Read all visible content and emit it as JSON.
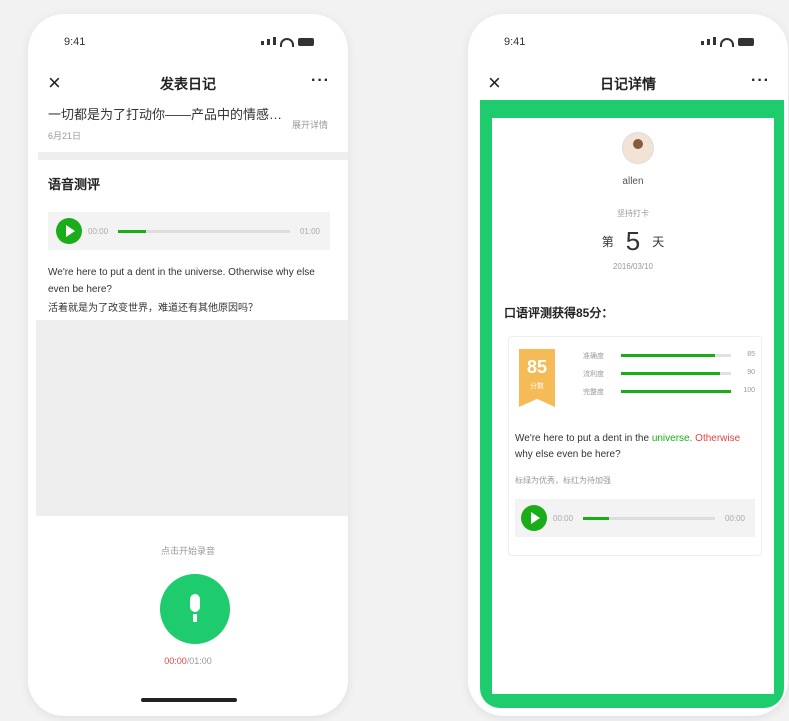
{
  "status_time": "9:41",
  "left": {
    "nav": {
      "close": "×",
      "title": "发表日记",
      "more": "···"
    },
    "entry": {
      "text": "一切都是为了打动你——产品中的情感…",
      "date": "6月21日",
      "link": "展开详情"
    },
    "voice_title": "语音测评",
    "player": {
      "current": "00:00",
      "duration": "01:00",
      "progress": 0.16
    },
    "english": "We're here to put a dent in the universe. Otherwise why else even be here?",
    "chinese": "活着就是为了改变世界，难道还有其他原因吗？",
    "record_hint": "点击开始录音",
    "timer": {
      "current": "00:00",
      "total": "/01:00"
    }
  },
  "right": {
    "nav": {
      "close": "×",
      "title": "日记详情",
      "more": "···"
    },
    "user_name": "allen",
    "streak_label": "坚持打卡",
    "day_prefix": "第",
    "day_number": "5",
    "day_suffix": "天",
    "date": "2016/03/10",
    "score_title": "口语评测获得85分：",
    "score": {
      "value": "85",
      "unit": "分数"
    },
    "metrics": [
      {
        "label": "准确度",
        "value": 85,
        "value_text": "85"
      },
      {
        "label": "流利度",
        "value": 90,
        "value_text": "90"
      },
      {
        "label": "完整度",
        "value": 100,
        "value_text": "100"
      }
    ],
    "sentence": {
      "part1": "We're here to put a dent in the ",
      "good_word": "universe.",
      "bad_word": "Otherwise",
      "part2": " why else even be here?"
    },
    "note": "标绿为优秀，标红为待加强",
    "player": {
      "current": "00:00",
      "duration": "00:00",
      "progress": 0.2
    }
  },
  "colors": {
    "brand_green": "#1ecb6d",
    "play_green": "#1aad19",
    "alert_red": "#e64340",
    "ribbon_orange": "#f5bb56"
  }
}
